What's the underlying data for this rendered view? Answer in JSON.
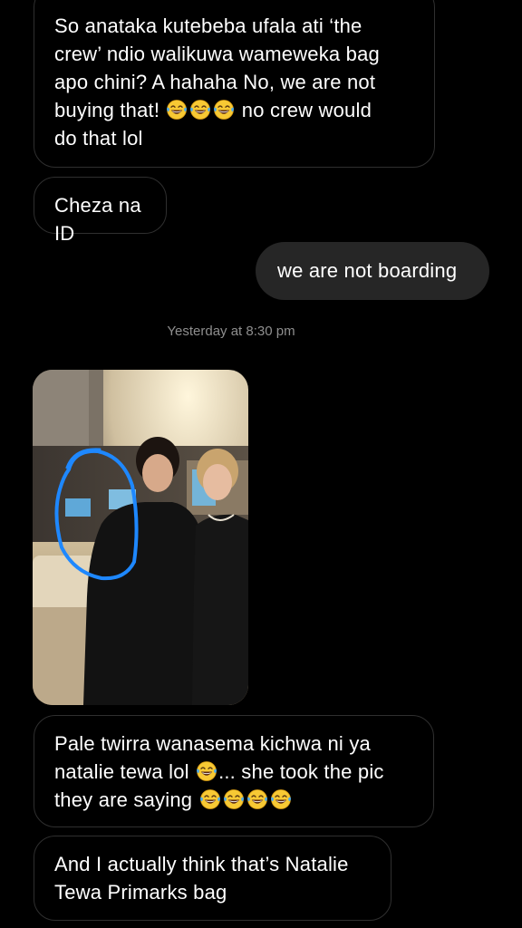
{
  "messages": [
    {
      "direction": "incoming",
      "lines": [
        "So anataka kutebeba ufala ati ‘the",
        "crew’ ndio walikuwa wameweka bag",
        "apo chini? A hahaha No, we are not",
        "buying that!",
        "no crew would",
        "do that lol"
      ],
      "emojis": [
        "face-with-tears-of-joy-icon",
        "face-with-tears-of-joy-icon",
        "face-with-tears-of-joy-icon"
      ]
    },
    {
      "direction": "incoming",
      "text": "Cheza na ID"
    },
    {
      "direction": "outgoing",
      "text": "we are not boarding"
    },
    {
      "direction": "incoming",
      "lines": [
        "Pale twirra wanasema kichwa ni ya",
        "natalie tewa lol",
        "... she took the pic",
        "they are saying"
      ],
      "emojis": [
        "face-with-tears-of-joy-icon",
        "face-with-tears-of-joy-icon",
        "face-with-tears-of-joy-icon",
        "face-with-tears-of-joy-icon",
        "face-with-tears-of-joy-icon"
      ]
    },
    {
      "direction": "incoming",
      "lines": [
        "And I actually think that’s Natalie",
        "Tewa Primarks bag"
      ]
    }
  ],
  "timestamp": "Yesterday at 8:30 pm",
  "photo": {
    "type": "image",
    "annotation_color": "#1e88ff"
  },
  "colors": {
    "background": "#000000",
    "outgoing_bubble": "#262626",
    "incoming_border": "#2f2f2f",
    "timestamp_text": "#8e8e8e"
  }
}
